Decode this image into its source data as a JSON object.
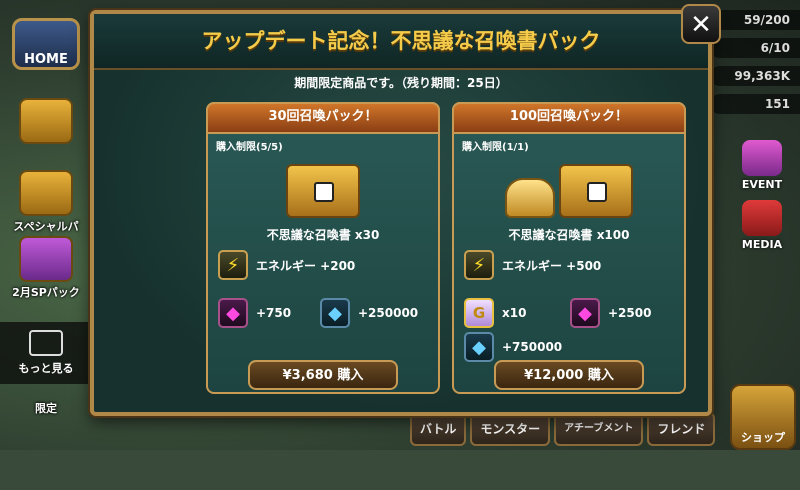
{
  "modal": {
    "title": "アップデート記念！不思議な召喚書パック",
    "close_label": "✕",
    "period": "期間限定商品です。（残り期間：25日）"
  },
  "packs": [
    {
      "header": "30回召喚パック！",
      "limit": "購入制限(5/5)",
      "content": "不思議な召喚書 x30",
      "energy": "エネルギー +200",
      "crystal": "+750",
      "mana": "+250000",
      "price": "¥3,680 購入"
    },
    {
      "header": "100回召喚パック！",
      "limit": "購入制限(1/1)",
      "content": "不思議な召喚書 x100",
      "energy": "エネルギー +500",
      "glory": "x10",
      "crystal": "+2500",
      "mana": "+750000",
      "price": "¥12,000 購入"
    }
  ],
  "left_rail": {
    "home": "HOME",
    "special": "スペシャルパック",
    "feb_sp": "2月SPパック",
    "more": "もっと見る",
    "limited": "限定"
  },
  "resources": [
    "59/200",
    "6/10",
    "99,363K",
    "151"
  ],
  "right_rail": {
    "event": "EVENT",
    "media": "MEDIA",
    "shop": "ショップ"
  },
  "bottom_tabs": [
    "バトル",
    "モンスター",
    "アチーブメント",
    "フレンド"
  ],
  "icons": {
    "energy": "lightning-icon",
    "crystal": "crystal-icon",
    "mana": "mana-stone-icon",
    "glory": "glory-point-icon"
  },
  "colors": {
    "title_gold": "#f5cc4a",
    "panel_header": "#d0762a",
    "frame": "#b08848"
  }
}
